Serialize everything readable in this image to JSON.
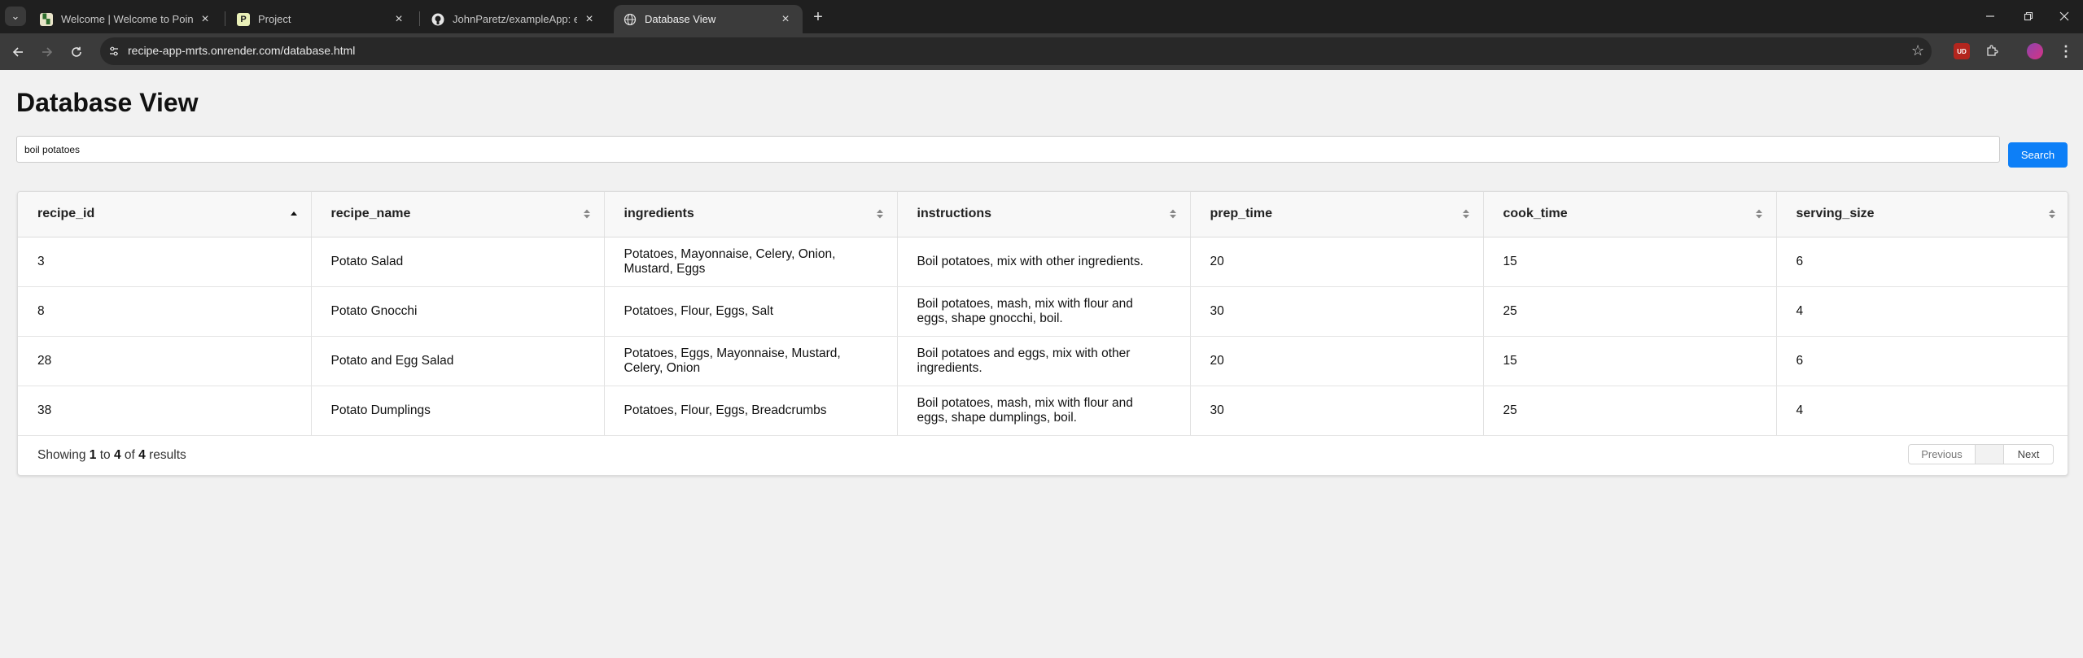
{
  "browser": {
    "tabs": [
      {
        "title": "Welcome | Welcome to PointWi",
        "favicon": "pointwise-favicon",
        "close": "×"
      },
      {
        "title": "Project",
        "favicon": "p-favicon",
        "close": "×"
      },
      {
        "title": "JohnParetz/exampleApp: example",
        "favicon": "github-favicon",
        "close": "×"
      },
      {
        "title": "Database View",
        "favicon": "globe-favicon",
        "close": "×"
      }
    ],
    "new_tab": "+",
    "url": "recipe-app-mrts.onrender.com/database.html",
    "extension_badge": "UD"
  },
  "page": {
    "title": "Database View",
    "search": {
      "value": "boil potatoes",
      "button": "Search"
    },
    "table": {
      "columns": [
        "recipe_id",
        "recipe_name",
        "ingredients",
        "instructions",
        "prep_time",
        "cook_time",
        "serving_size"
      ],
      "sorted_column": "recipe_id",
      "sort_direction": "ascending",
      "rows": [
        [
          "3",
          "Potato Salad",
          "Potatoes, Mayonnaise, Celery, Onion, Mustard, Eggs",
          "Boil potatoes, mix with other ingredients.",
          "20",
          "15",
          "6"
        ],
        [
          "8",
          "Potato Gnocchi",
          "Potatoes, Flour, Eggs, Salt",
          "Boil potatoes, mash, mix with flour and eggs, shape gnocchi, boil.",
          "30",
          "25",
          "4"
        ],
        [
          "28",
          "Potato and Egg Salad",
          "Potatoes, Eggs, Mayonnaise, Mustard, Celery, Onion",
          "Boil potatoes and eggs, mix with other ingredients.",
          "20",
          "15",
          "6"
        ],
        [
          "38",
          "Potato Dumplings",
          "Potatoes, Flour, Eggs, Breadcrumbs",
          "Boil potatoes, mash, mix with flour and eggs, shape dumplings, boil.",
          "30",
          "25",
          "4"
        ]
      ]
    },
    "footer": {
      "showing": "Showing",
      "from": "1",
      "to_word": "to",
      "to": "4",
      "of_word": "of",
      "total": "4",
      "results_word": "results"
    },
    "pagination": {
      "previous": "Previous",
      "page": "",
      "next": "Next"
    }
  },
  "colors": {
    "accent": "#0d7ff7",
    "page_bg": "#f1f1f1",
    "chrome_bg": "#1f1f1f"
  }
}
